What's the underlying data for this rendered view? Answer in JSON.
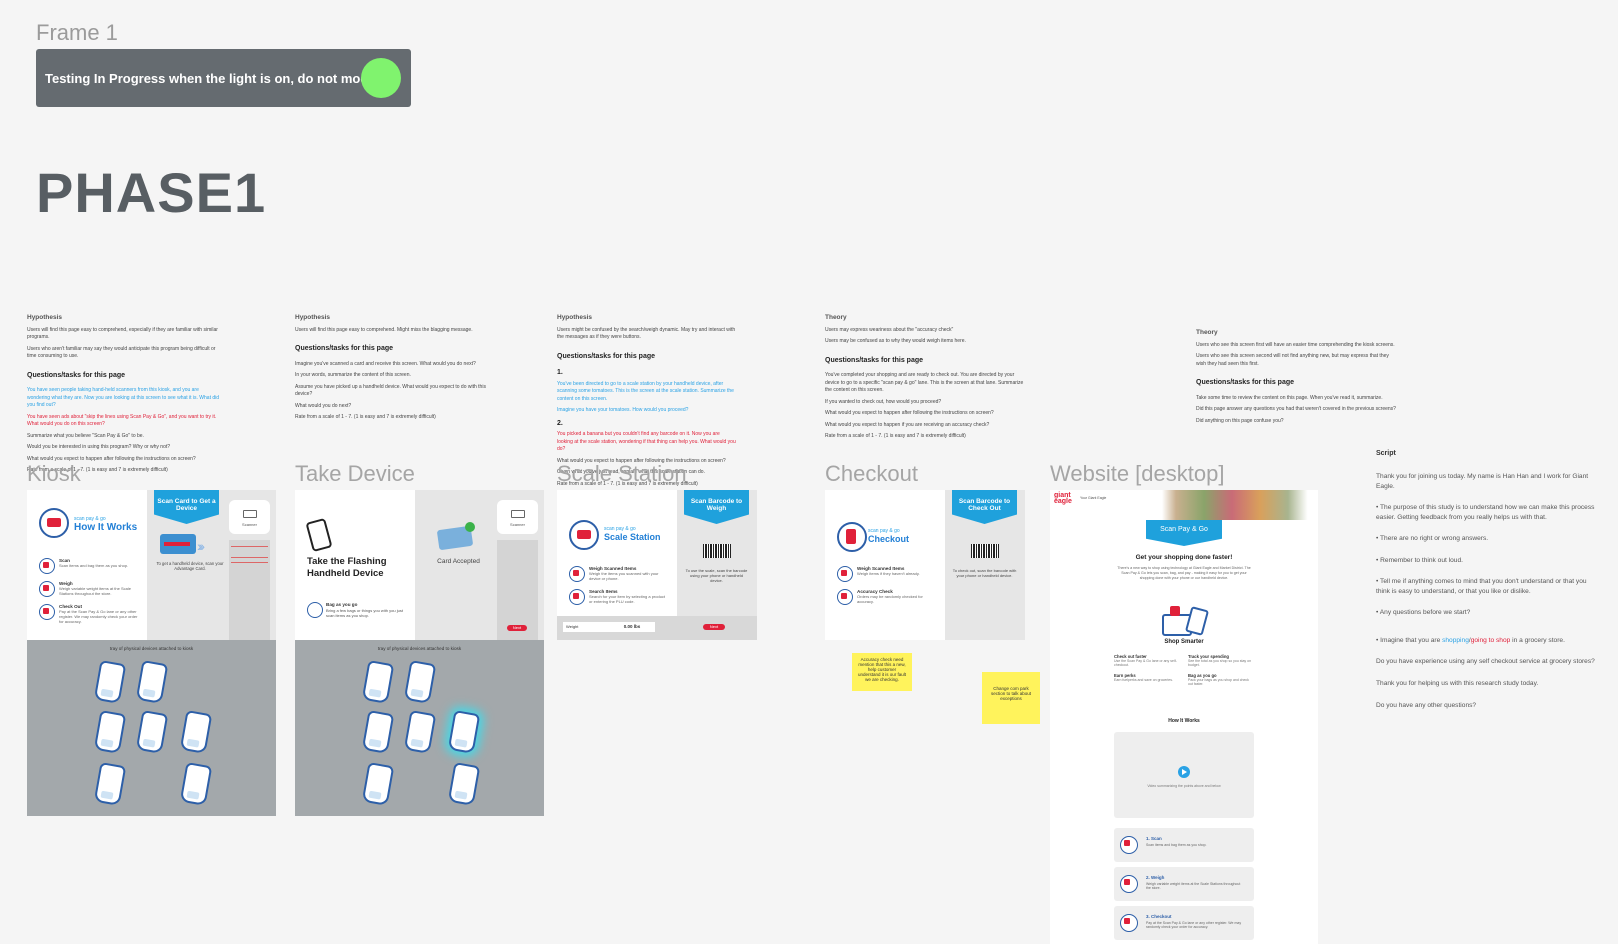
{
  "frame_label": "Frame 1",
  "banner": {
    "text": "Testing In Progress when the light is on, do not modify!",
    "light_color": "#80f36e"
  },
  "phase_title": "PHASE1",
  "notes": {
    "col1": {
      "heading": "Hypothesis",
      "lines": [
        "Users will find this page easy to comprehend, especially if they are familiar with similar programs.",
        "Users who aren't familiar may say they would anticipate this program being difficult or time consuming to use."
      ],
      "tasks_heading": "Questions/tasks for this page",
      "tasks": [
        {
          "text": "You have seen people taking hand-held scanners from this kiosk, and you are wondering what they are. Now you are looking at this screen to see what it is. What did you find out?",
          "color": "blue"
        },
        {
          "text": "You have seen ads about \"skip the lines using Scan Pay & Go\", and you want to try it. What would you do on this screen?",
          "color": "red"
        },
        {
          "text": "Summarize what you believe \"Scan Pay & Go\" to be.",
          "color": ""
        },
        {
          "text": "Would you be interested in using this program? Why or why not?",
          "color": ""
        },
        {
          "text": "What would you expect to happen after following the instructions on screen?",
          "color": ""
        },
        {
          "text": "Rate from a scale of 1 - 7. (1 is easy and 7 is extremely difficult)",
          "color": ""
        }
      ]
    },
    "col2": {
      "heading": "Hypothesis",
      "lines": [
        "Users will find this page easy to comprehend. Might miss the blagging message."
      ],
      "tasks_heading": "Questions/tasks for this page",
      "tasks": [
        {
          "text": "Imagine you've scanned a card and receive this screen. What would you do next?",
          "color": ""
        },
        {
          "text": "In your words, summarize the content of this screen.",
          "color": ""
        },
        {
          "text": "Assume you have picked up a handheld device. What would you expect to do with this device?",
          "color": ""
        },
        {
          "text": "What would you do next?",
          "color": ""
        },
        {
          "text": "Rate from a scale of 1 - 7. (1 is easy and 7 is extremely difficult)",
          "color": ""
        }
      ]
    },
    "col3": {
      "heading": "Hypothesis",
      "lines": [
        "Users might be confused by the search/weigh dynamic. May try and interact with the messages as if they were buttons."
      ],
      "tasks_heading": "Questions/tasks for this page",
      "tasks": [
        {
          "text": "1.",
          "color": "num"
        },
        {
          "text": "You've been directed to go to a scale station by your handheld device, after scanning some tomatoes. This is the screen at the scale station. Summarize the content on this screen.",
          "color": "blue"
        },
        {
          "text": "Imagine you have your tomatoes. How would you proceed?",
          "color": "blue"
        },
        {
          "text": "2.",
          "color": "num"
        },
        {
          "text": "You picked a banana but you couldn't find any barcode on it. Now you are looking at the scale station, wondering if that thing can help you. What would you do?",
          "color": "red"
        },
        {
          "text": "What would you expect to happen after following the instructions on screen?",
          "color": ""
        },
        {
          "text": "Given what you've just read, explain what this scale station can do.",
          "color": ""
        },
        {
          "text": "Rate from a scale of 1 - 7. (1 is easy and 7 is extremely difficult)",
          "color": ""
        }
      ]
    },
    "col4": {
      "heading": "Theory",
      "lines": [
        "Users may express weariness about the \"accuracy check\"",
        "Users may be confused as to why they would weigh items here."
      ],
      "tasks_heading": "Questions/tasks for this page",
      "tasks": [
        {
          "text": "You've completed your shopping and are ready to check out. You are directed by your device to go to a specific \"scan pay & go\" lane. This is the screen at that lane. Summarize the content on this screen.",
          "color": ""
        },
        {
          "text": "If you wanted to check out, how would you proceed?",
          "color": ""
        },
        {
          "text": "What would you expect to happen after following the instructions on screen?",
          "color": ""
        },
        {
          "text": "What would you expect to happen if you are receiving an accuracy check?",
          "color": ""
        },
        {
          "text": "Rate from a scale of 1 - 7. (1 is easy and 7 is extremely difficult)",
          "color": ""
        }
      ]
    },
    "col5": {
      "heading": "Theory",
      "lines": [
        "Users who see this screen first will have an easier time comprehending the kiosk screens.",
        "Users who see this screen second will not find anything new, but may express that they wish they had seen this first."
      ],
      "tasks_heading": "Questions/tasks for this page",
      "tasks": [
        {
          "text": "Take some time to review the content on this page. When you've read it, summarize.",
          "color": ""
        },
        {
          "text": "Did this page answer any questions you had that weren't covered in the previous screens?",
          "color": ""
        },
        {
          "text": "Did anything on this page confuse you?",
          "color": ""
        }
      ]
    }
  },
  "sections": {
    "kiosk": "Kiosk",
    "take_device": "Take Device",
    "scale_station": "Scale Station",
    "checkout": "Checkout",
    "website": "Website [desktop]",
    "script": "Script"
  },
  "kiosk_screen": {
    "brand": "scan pay & go",
    "title": "How It Works",
    "ribbon": "Scan Card to Get a Device",
    "steps": [
      {
        "title": "Scan",
        "desc": "Scan items and bag them as you shop."
      },
      {
        "title": "Weigh",
        "desc": "Weigh variable weight items at the Scale Stations throughout the store."
      },
      {
        "title": "Check Out",
        "desc": "Pay at the Scan Pay & Go lane or any other register. We may randomly check your order for accuracy."
      }
    ],
    "card_caption": "To get a handheld device, scan your Advantage Card.",
    "scanner_label": "Scanner",
    "tray_label": "tray of physical devices attached to kiosk"
  },
  "take_device_screen": {
    "title": "Take the Flashing Handheld Device",
    "card_status": "Card Accepted",
    "bag_title": "Bag as you go",
    "bag_desc": "Bring a few bags or things you with you just scan items as you shop.",
    "scanner_label": "Scanner",
    "next": "Next",
    "tray_label": "tray of physical devices attached to kiosk"
  },
  "scale_screen": {
    "brand": "scan pay & go",
    "title": "Scale Station",
    "ribbon": "Scan Barcode to Weigh",
    "items": [
      {
        "title": "Weigh Scanned Items",
        "desc": "Weigh the items you scanned with your device or phone."
      },
      {
        "title": "Search Items",
        "desc": "Search for your item by selecting a product or entering the PLU code."
      }
    ],
    "caption": "To use the scale, scan the barcode using your phone or handheld device.",
    "weight_label": "Weight",
    "weight_value": "0.00 lbs",
    "next": "Next"
  },
  "checkout_screen": {
    "brand": "scan pay & go",
    "title": "Checkout",
    "ribbon": "Scan Barcode to Check Out",
    "items": [
      {
        "title": "Weigh Scanned Items",
        "desc": "Weigh items if they haven't already."
      },
      {
        "title": "Accuracy Check",
        "desc": "Orders may be randomly checked for accuracy."
      }
    ],
    "caption": "To check out, scan the barcode with your phone or handheld device.",
    "sticky1": "Accuracy check need mention that this a new, help customer understand it is our fault we are checking.",
    "sticky2": "Change com park section to talk about exceptions"
  },
  "website": {
    "brand": "giant eagle",
    "store": "Your Giant Eagle",
    "hero_button": "Scan Pay & Go",
    "headline": "Get your shopping done faster!",
    "intro": "There's a new way to shop using technology at Giant Eagle and Market District. The Scan Pay & Go lets you scan, bag, and pay - making it easy for you to get your shopping done with your phone or our handheld device.",
    "shop_smarter": "Shop Smarter",
    "benefits": [
      {
        "title": "Check out faster",
        "desc": "Use the Scan Pay & Go lane or any self-checkout."
      },
      {
        "title": "Track your spending",
        "desc": "See the total as you shop so you stay on budget."
      },
      {
        "title": "Earn perks",
        "desc": "Earn fuelperks and save on groceries."
      },
      {
        "title": "Bag as you go",
        "desc": "Pack your bags as you shop and check out faster."
      }
    ],
    "how_it_works": "How It Works",
    "video_caption": "Video summarizing the points above and below",
    "steps": [
      {
        "title": "1. Scan",
        "desc": "Scan items and bag them as you shop."
      },
      {
        "title": "2. Weigh",
        "desc": "Weigh variable weight items at the Scale Stations throughout the store."
      },
      {
        "title": "3. Checkout",
        "desc": "Pay at the Scan Pay & Go lane or any other register. We may randomly check your order for accuracy."
      }
    ]
  },
  "script": {
    "lines": [
      "Thank you for joining us today. My name is Han Han and I work for Giant Eagle.",
      "• The purpose of this study is to understand how we can make this process easier. Getting feedback from you really helps us with that.",
      "• There are no right or wrong answers.",
      "• Remember to think out loud.",
      "• Tell me if anything comes to mind that you don't understand or that you think is easy to understand, or that you like or dislike.",
      "• Any questions before we start?"
    ],
    "imagine_prefix": "• Imagine that you are ",
    "imagine_shopping": "shopping",
    "imagine_slash": "/",
    "imagine_going": "going to shop",
    "imagine_suffix": " in a grocery store.",
    "after": [
      "Do you have experience using any self checkout service at grocery stores?",
      "Thank you for helping us with this research study today.",
      "Do you have any other questions?"
    ]
  }
}
